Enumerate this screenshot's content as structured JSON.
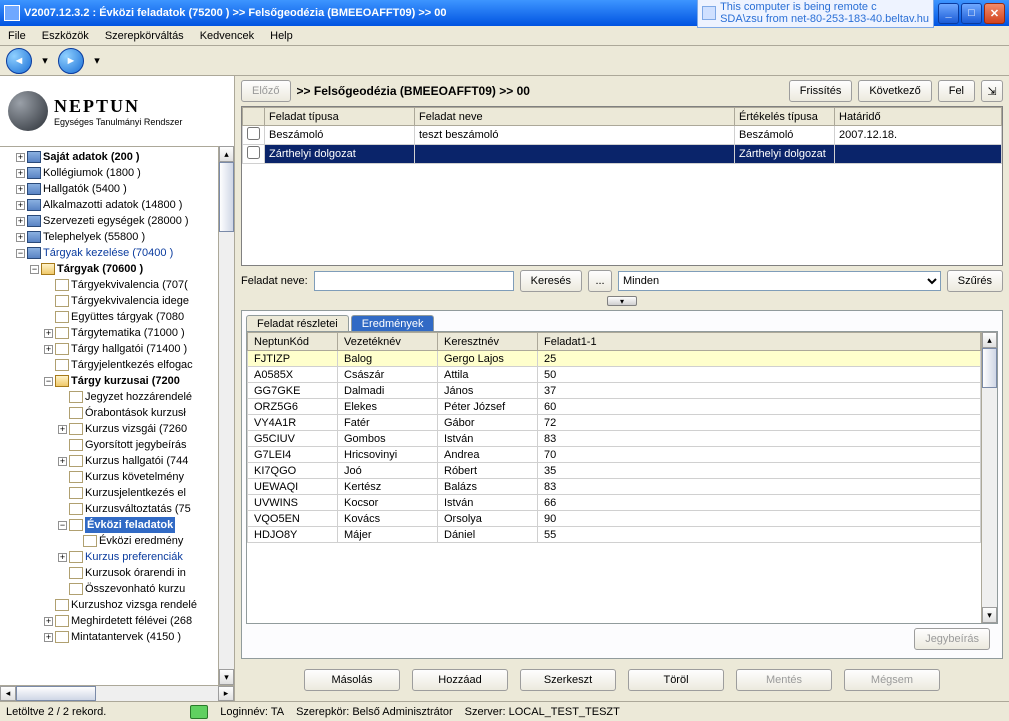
{
  "title": "V2007.12.3.2 : Évközi feladatok (75200  )  >> Felsőgeodézia (BMEEOAFFT09) >> 00",
  "remote_notice": {
    "line1": "This computer is being remote c",
    "line2": "SDA\\zsu from net-80-253-183-40.beltav.hu"
  },
  "menu": [
    "File",
    "Eszközök",
    "Szerepkörváltás",
    "Kedvencek",
    "Help"
  ],
  "brand": {
    "name": "NEPTUN",
    "sub": "Egységes Tanulmányi Rendszer"
  },
  "tree": {
    "n0": "Saját adatok (200  )",
    "n1": "Kollégiumok (1800  )",
    "n2": "Hallgatók (5400  )",
    "n3": "Alkalmazotti adatok (14800  )",
    "n4": "Szervezeti egységek (28000  )",
    "n5": "Telephelyek (55800  )",
    "n6": "Tárgyak kezelése (70400  )",
    "n6a": "Tárgyak (70600  )",
    "t0": "Tárgyekvivalencia (707(",
    "t1": "Tárgyekvivalencia idege",
    "t2": "Együttes tárgyak (7080",
    "t3": "Tárgytematika (71000  )",
    "t4": "Tárgy hallgatói (71400  )",
    "t5": "Tárgyjelentkezés elfogac",
    "t6": "Tárgy kurzusai (7200",
    "k0": "Jegyzet hozzárendelé",
    "k1": "Órabontások kurzusł",
    "k2": "Kurzus vizsgái (7260",
    "k3": "Gyorsított jegybeírás",
    "k4": "Kurzus hallgatói (744",
    "k5": "Kurzus követelmény",
    "k6": "Kurzusjelentkezés el",
    "k7": "Kurzusváltoztatás (75",
    "k8": "Évközi feladatok",
    "k8a": "Évközi eredmény",
    "k9": "Kurzus preferenciák",
    "k10": "Kurzusok órarendi in",
    "k11": "Összevonható kurzu",
    "t7": "Kurzushoz vizsga rendelé",
    "t8": "Meghirdetett félévei (268",
    "t9": "Mintatantervek (4150  )"
  },
  "toolbar": {
    "prev": "Előző",
    "breadcrumb": ">>  Felsőgeodézia (BMEEOAFFT09) >> 00",
    "refresh": "Frissítés",
    "next": "Következő",
    "up": "Fel"
  },
  "task_table": {
    "cols": [
      "Feladat típusa",
      "Feladat neve",
      "Értékelés típusa",
      "Határidő"
    ],
    "rows": [
      {
        "c0": "Beszámoló",
        "c1": "teszt beszámoló",
        "c2": "Beszámoló",
        "c3": "2007.12.18."
      },
      {
        "c0": "Zárthelyi dolgozat",
        "c1": "",
        "c2": "Zárthelyi dolgozat",
        "c3": ""
      }
    ]
  },
  "search": {
    "label": "Feladat neve:",
    "btn": "Keresés",
    "dots": "...",
    "filter": "Minden",
    "szures": "Szűrés"
  },
  "tabs": {
    "t0": "Feladat részletei",
    "t1": "Eredmények"
  },
  "results": {
    "cols": [
      "NeptunKód",
      "Vezetéknév",
      "Keresztnév",
      "Feladat1-1"
    ],
    "rows": [
      {
        "c0": "FJTIZP",
        "c1": "Balog",
        "c2": "Gergo Lajos",
        "c3": "25"
      },
      {
        "c0": "A0585X",
        "c1": "Császár",
        "c2": "Attila",
        "c3": "50"
      },
      {
        "c0": "GG7GKE",
        "c1": "Dalmadi",
        "c2": "János",
        "c3": "37"
      },
      {
        "c0": "ORZ5G6",
        "c1": "Elekes",
        "c2": "Péter József",
        "c3": "60"
      },
      {
        "c0": "VY4A1R",
        "c1": "Fatér",
        "c2": "Gábor",
        "c3": "72"
      },
      {
        "c0": "G5CIUV",
        "c1": "Gombos",
        "c2": "István",
        "c3": "83"
      },
      {
        "c0": "G7LEI4",
        "c1": "Hricsovinyi",
        "c2": "Andrea",
        "c3": "70"
      },
      {
        "c0": "KI7QGO",
        "c1": "Joó",
        "c2": "Róbert",
        "c3": "35"
      },
      {
        "c0": "UEWAQI",
        "c1": "Kertész",
        "c2": "Balázs",
        "c3": "83"
      },
      {
        "c0": "UVWINS",
        "c1": "Kocsor",
        "c2": "István",
        "c3": "66"
      },
      {
        "c0": "VQO5EN",
        "c1": "Kovács",
        "c2": "Orsolya",
        "c3": "90"
      },
      {
        "c0": "HDJO8Y",
        "c1": "Májer",
        "c2": "Dániel",
        "c3": "55"
      }
    ]
  },
  "jegy": "Jegybeírás",
  "buttons": {
    "copy": "Másolás",
    "add": "Hozzáad",
    "edit": "Szerkeszt",
    "del": "Töröl",
    "save": "Mentés",
    "cancel": "Mégsem"
  },
  "status": {
    "records": "Letöltve 2 / 2 rekord.",
    "login": "Loginnév: TA",
    "role": "Szerepkör: Belső Adminisztrátor",
    "server": "Szerver: LOCAL_TEST_TESZT"
  }
}
